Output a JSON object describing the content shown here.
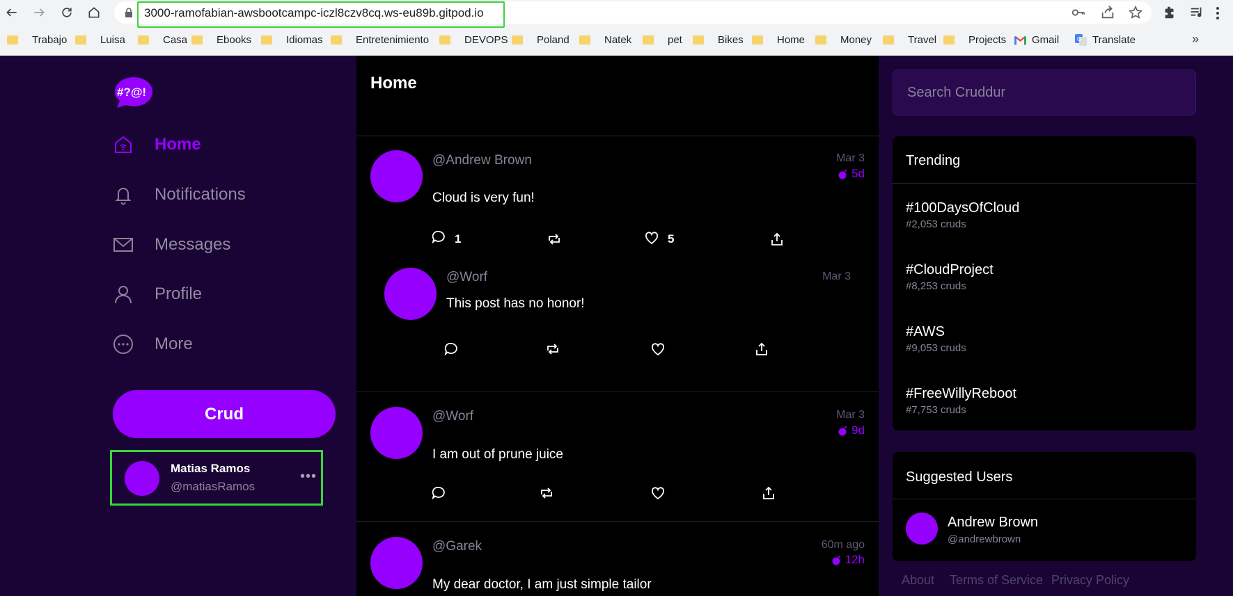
{
  "browser": {
    "url": "3000-ramofabian-awsbootcampc-iczl8czv8cq.ws-eu89b.gitpod.io",
    "icons": [
      "back-arrow-icon",
      "forward-arrow-icon",
      "reload-icon",
      "home-icon",
      "lock-icon",
      "key-icon",
      "share-icon",
      "star-icon",
      "extensions-icon",
      "media-icon"
    ],
    "bookmarks": [
      "Trabajo",
      "Luisa",
      "Casa",
      "Ebooks",
      "Idiomas",
      "Entretenimiento",
      "DEVOPS",
      "Poland",
      "Natek",
      "pet",
      "Bikes",
      "Home",
      "Money",
      "Travel",
      "Projects",
      "Gmail",
      "Translate"
    ],
    "bookmarks_more": "»"
  },
  "logo_text": "#?@!",
  "nav": {
    "items": [
      {
        "label": "Home",
        "icon": "home-icon",
        "active": true
      },
      {
        "label": "Notifications",
        "icon": "bell-icon"
      },
      {
        "label": "Messages",
        "icon": "mail-icon"
      },
      {
        "label": "Profile",
        "icon": "user-icon"
      },
      {
        "label": "More",
        "icon": "more-circle-icon"
      }
    ],
    "crud_label": "Crud"
  },
  "profile": {
    "name": "Matias Ramos",
    "handle": "@matiasRamos",
    "more": "•••"
  },
  "feed": {
    "title": "Home",
    "posts": [
      {
        "handle": "@Andrew Brown",
        "message": "Cloud is very fun!",
        "date": "Mar 3",
        "age": "5d",
        "replies": "1",
        "likes": "5"
      },
      {
        "handle": "@Worf",
        "message": "This post has no honor!",
        "date": "Mar 3"
      },
      {
        "handle": "@Worf",
        "message": "I am out of prune juice",
        "date": "Mar 3",
        "age": "9d"
      },
      {
        "handle": "@Garek",
        "message": "My dear doctor, I am just simple tailor",
        "date": "60m ago",
        "age": "12h"
      }
    ]
  },
  "search": {
    "placeholder": "Search Cruddur"
  },
  "trending": {
    "title": "Trending",
    "items": [
      {
        "tag": "#100DaysOfCloud",
        "count": "#2,053 cruds"
      },
      {
        "tag": "#CloudProject",
        "count": "#8,253 cruds"
      },
      {
        "tag": "#AWS",
        "count": "#9,053 cruds"
      },
      {
        "tag": "#FreeWillyReboot",
        "count": "#7,753 cruds"
      }
    ]
  },
  "suggested": {
    "title": "Suggested Users",
    "users": [
      {
        "name": "Andrew Brown",
        "handle": "@andrewbrown"
      }
    ]
  },
  "footer": {
    "links": [
      "About",
      "Terms of Service",
      "Privacy Policy"
    ]
  },
  "colors": {
    "accent": "#9500ff",
    "background": "#1a0436",
    "feed_background": "#000000",
    "highlight": "#3bd33b"
  }
}
